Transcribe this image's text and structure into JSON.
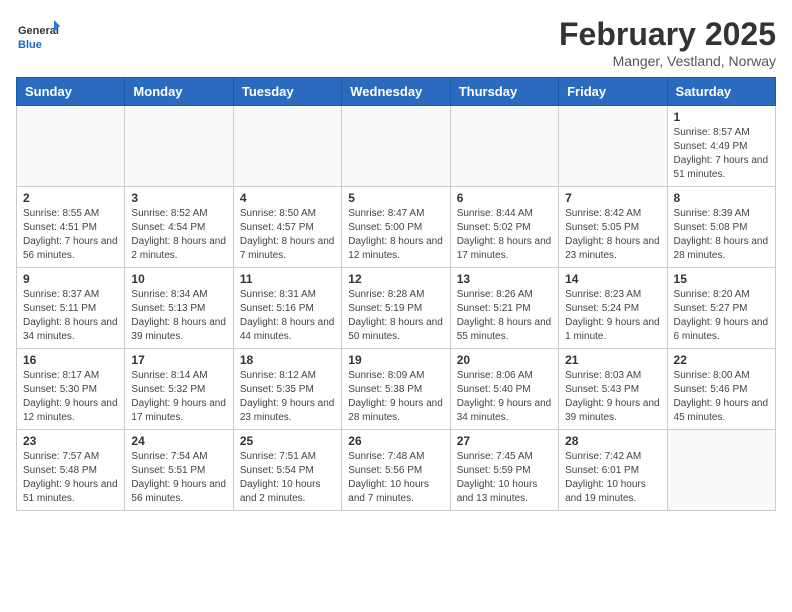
{
  "header": {
    "logo_general": "General",
    "logo_blue": "Blue",
    "month_title": "February 2025",
    "location": "Manger, Vestland, Norway"
  },
  "days_of_week": [
    "Sunday",
    "Monday",
    "Tuesday",
    "Wednesday",
    "Thursday",
    "Friday",
    "Saturday"
  ],
  "weeks": [
    [
      {
        "day": "",
        "info": ""
      },
      {
        "day": "",
        "info": ""
      },
      {
        "day": "",
        "info": ""
      },
      {
        "day": "",
        "info": ""
      },
      {
        "day": "",
        "info": ""
      },
      {
        "day": "",
        "info": ""
      },
      {
        "day": "1",
        "info": "Sunrise: 8:57 AM\nSunset: 4:49 PM\nDaylight: 7 hours and 51 minutes."
      }
    ],
    [
      {
        "day": "2",
        "info": "Sunrise: 8:55 AM\nSunset: 4:51 PM\nDaylight: 7 hours and 56 minutes."
      },
      {
        "day": "3",
        "info": "Sunrise: 8:52 AM\nSunset: 4:54 PM\nDaylight: 8 hours and 2 minutes."
      },
      {
        "day": "4",
        "info": "Sunrise: 8:50 AM\nSunset: 4:57 PM\nDaylight: 8 hours and 7 minutes."
      },
      {
        "day": "5",
        "info": "Sunrise: 8:47 AM\nSunset: 5:00 PM\nDaylight: 8 hours and 12 minutes."
      },
      {
        "day": "6",
        "info": "Sunrise: 8:44 AM\nSunset: 5:02 PM\nDaylight: 8 hours and 17 minutes."
      },
      {
        "day": "7",
        "info": "Sunrise: 8:42 AM\nSunset: 5:05 PM\nDaylight: 8 hours and 23 minutes."
      },
      {
        "day": "8",
        "info": "Sunrise: 8:39 AM\nSunset: 5:08 PM\nDaylight: 8 hours and 28 minutes."
      }
    ],
    [
      {
        "day": "9",
        "info": "Sunrise: 8:37 AM\nSunset: 5:11 PM\nDaylight: 8 hours and 34 minutes."
      },
      {
        "day": "10",
        "info": "Sunrise: 8:34 AM\nSunset: 5:13 PM\nDaylight: 8 hours and 39 minutes."
      },
      {
        "day": "11",
        "info": "Sunrise: 8:31 AM\nSunset: 5:16 PM\nDaylight: 8 hours and 44 minutes."
      },
      {
        "day": "12",
        "info": "Sunrise: 8:28 AM\nSunset: 5:19 PM\nDaylight: 8 hours and 50 minutes."
      },
      {
        "day": "13",
        "info": "Sunrise: 8:26 AM\nSunset: 5:21 PM\nDaylight: 8 hours and 55 minutes."
      },
      {
        "day": "14",
        "info": "Sunrise: 8:23 AM\nSunset: 5:24 PM\nDaylight: 9 hours and 1 minute."
      },
      {
        "day": "15",
        "info": "Sunrise: 8:20 AM\nSunset: 5:27 PM\nDaylight: 9 hours and 6 minutes."
      }
    ],
    [
      {
        "day": "16",
        "info": "Sunrise: 8:17 AM\nSunset: 5:30 PM\nDaylight: 9 hours and 12 minutes."
      },
      {
        "day": "17",
        "info": "Sunrise: 8:14 AM\nSunset: 5:32 PM\nDaylight: 9 hours and 17 minutes."
      },
      {
        "day": "18",
        "info": "Sunrise: 8:12 AM\nSunset: 5:35 PM\nDaylight: 9 hours and 23 minutes."
      },
      {
        "day": "19",
        "info": "Sunrise: 8:09 AM\nSunset: 5:38 PM\nDaylight: 9 hours and 28 minutes."
      },
      {
        "day": "20",
        "info": "Sunrise: 8:06 AM\nSunset: 5:40 PM\nDaylight: 9 hours and 34 minutes."
      },
      {
        "day": "21",
        "info": "Sunrise: 8:03 AM\nSunset: 5:43 PM\nDaylight: 9 hours and 39 minutes."
      },
      {
        "day": "22",
        "info": "Sunrise: 8:00 AM\nSunset: 5:46 PM\nDaylight: 9 hours and 45 minutes."
      }
    ],
    [
      {
        "day": "23",
        "info": "Sunrise: 7:57 AM\nSunset: 5:48 PM\nDaylight: 9 hours and 51 minutes."
      },
      {
        "day": "24",
        "info": "Sunrise: 7:54 AM\nSunset: 5:51 PM\nDaylight: 9 hours and 56 minutes."
      },
      {
        "day": "25",
        "info": "Sunrise: 7:51 AM\nSunset: 5:54 PM\nDaylight: 10 hours and 2 minutes."
      },
      {
        "day": "26",
        "info": "Sunrise: 7:48 AM\nSunset: 5:56 PM\nDaylight: 10 hours and 7 minutes."
      },
      {
        "day": "27",
        "info": "Sunrise: 7:45 AM\nSunset: 5:59 PM\nDaylight: 10 hours and 13 minutes."
      },
      {
        "day": "28",
        "info": "Sunrise: 7:42 AM\nSunset: 6:01 PM\nDaylight: 10 hours and 19 minutes."
      },
      {
        "day": "",
        "info": ""
      }
    ]
  ]
}
